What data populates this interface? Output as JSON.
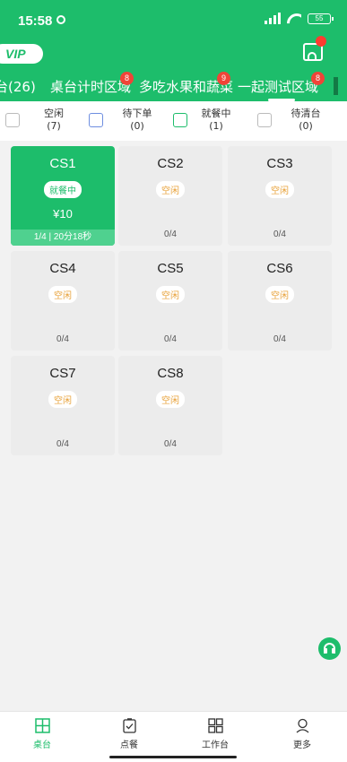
{
  "status": {
    "time": "15:58",
    "battery": "55"
  },
  "vip_label": "VIP",
  "tabs": [
    {
      "label": "台(26)",
      "badge": ""
    },
    {
      "label": "桌台计时区域",
      "badge": "8"
    },
    {
      "label": "多吃水果和蔬菜",
      "badge": "9"
    },
    {
      "label": "一起测试区域",
      "badge": "8"
    }
  ],
  "legend": [
    {
      "label": "空闲",
      "count": "(7)"
    },
    {
      "label": "待下单",
      "count": "(0)"
    },
    {
      "label": "就餐中",
      "count": "(1)"
    },
    {
      "label": "待清台",
      "count": "(0)"
    }
  ],
  "tables": [
    {
      "name": "CS1",
      "status": "就餐中",
      "amount": "¥10",
      "footer": "1/4 | 20分18秒",
      "active": true
    },
    {
      "name": "CS2",
      "status": "空闲",
      "footer": "0/4"
    },
    {
      "name": "CS3",
      "status": "空闲",
      "footer": "0/4"
    },
    {
      "name": "CS4",
      "status": "空闲",
      "footer": "0/4"
    },
    {
      "name": "CS5",
      "status": "空闲",
      "footer": "0/4"
    },
    {
      "name": "CS6",
      "status": "空闲",
      "footer": "0/4"
    },
    {
      "name": "CS7",
      "status": "空闲",
      "footer": "0/4"
    },
    {
      "name": "CS8",
      "status": "空闲",
      "footer": "0/4"
    }
  ],
  "nav": [
    {
      "label": "桌台",
      "icon": "table-icon",
      "active": true
    },
    {
      "label": "点餐",
      "icon": "order-icon"
    },
    {
      "label": "工作台",
      "icon": "grid-icon"
    },
    {
      "label": "更多",
      "icon": "user-icon"
    }
  ],
  "colors": {
    "primary": "#1dbd6b",
    "badge_red": "#f04438",
    "idle_text": "#e8a23a"
  }
}
